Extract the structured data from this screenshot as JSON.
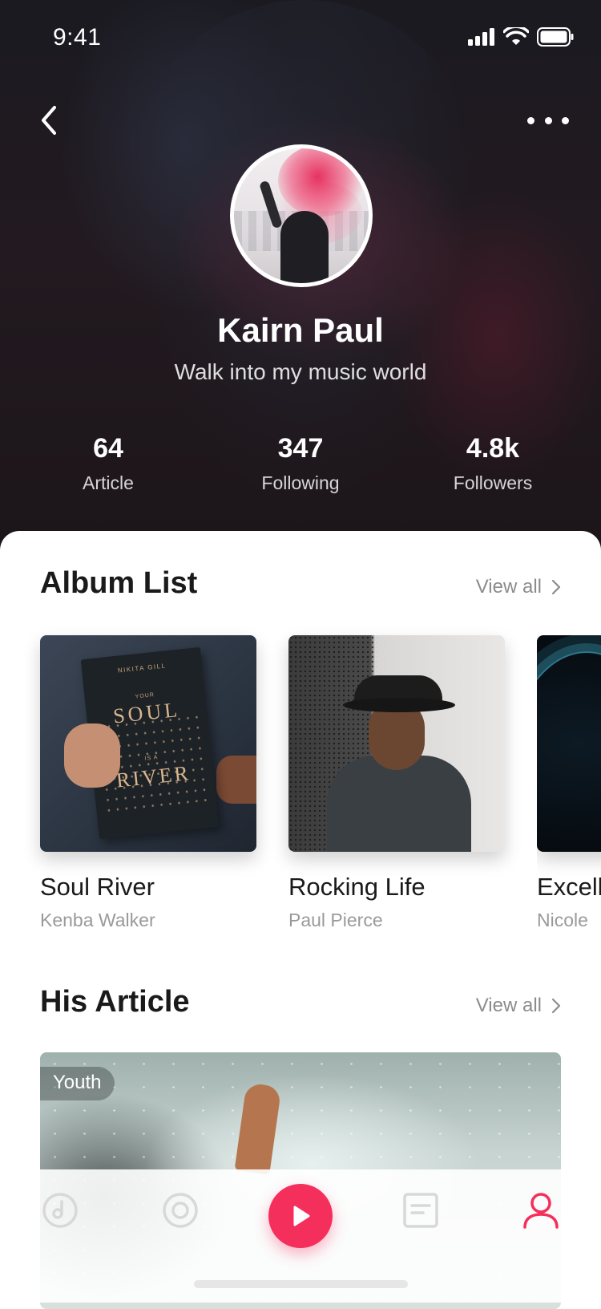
{
  "status_bar": {
    "time": "9:41"
  },
  "profile": {
    "name": "Kairn Paul",
    "tagline": "Walk into my music world",
    "stats": [
      {
        "value": "64",
        "label": "Article"
      },
      {
        "value": "347",
        "label": "Following"
      },
      {
        "value": "4.8k",
        "label": "Followers"
      }
    ]
  },
  "albums_section": {
    "title": "Album List",
    "view_all": "View all",
    "items": [
      {
        "title": "Soul River",
        "artist": "Kenba Walker",
        "cover_text": {
          "author": "NIKITA GILL",
          "line1": "YOUR",
          "line2": "SOUL",
          "line3": "IS A",
          "line4": "RIVER"
        }
      },
      {
        "title": "Rocking Life",
        "artist": "Paul Pierce"
      },
      {
        "title": "Excell",
        "artist": "Nicole"
      }
    ]
  },
  "articles_section": {
    "title": "His Article",
    "view_all": "View all",
    "featured": {
      "tag": "Youth"
    }
  },
  "tab_bar": {
    "items": [
      {
        "icon": "music-disc-icon",
        "active": false
      },
      {
        "icon": "radio-icon",
        "active": false
      },
      {
        "icon": "play-icon",
        "active": false,
        "primary": true
      },
      {
        "icon": "article-icon",
        "active": false
      },
      {
        "icon": "profile-icon",
        "active": true
      }
    ],
    "accent": "#f52f5c",
    "inactive": "#d8d8d8"
  }
}
